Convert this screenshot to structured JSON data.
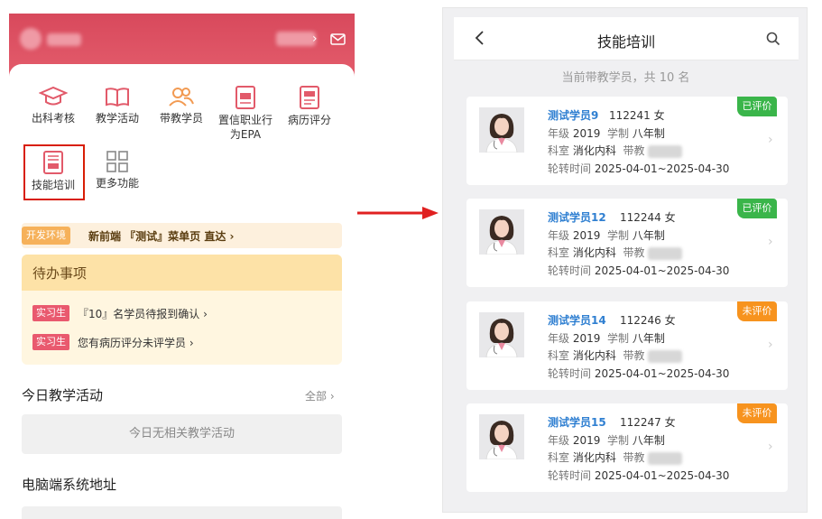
{
  "colors": {
    "accent": "#d8495c",
    "evaluated": "#3ab54a",
    "not_evaluated": "#f7931e",
    "link": "#2f7fd1",
    "highlight": "#d81e06"
  },
  "left": {
    "functions": [
      {
        "label": "出科考核",
        "icon": "graduation-cap-icon"
      },
      {
        "label": "教学活动",
        "icon": "book-icon"
      },
      {
        "label": "带教学员",
        "icon": "students-icon"
      },
      {
        "label": "置信职业行为EPA",
        "icon": "epa-icon"
      },
      {
        "label": "病历评分",
        "icon": "record-icon"
      },
      {
        "label": "技能培训",
        "icon": "skill-training-icon",
        "highlighted": true
      },
      {
        "label": "更多功能",
        "icon": "grid-icon"
      }
    ],
    "dev_banner": {
      "tag": "开发环境",
      "text": "新前端 『测试』菜单页 直达 ›"
    },
    "todo": {
      "title": "待办事项",
      "items": [
        {
          "tag": "实习生",
          "text": "『10』名学员待报到确认 ›"
        },
        {
          "tag": "实习生",
          "text": "您有病历评分未评学员 ›"
        }
      ]
    },
    "today": {
      "title": "今日教学活动",
      "all": "全部 ›",
      "empty": "今日无相关教学活动"
    },
    "pc_address": {
      "title": "电脑端系统地址"
    }
  },
  "right": {
    "title": "技能培训",
    "summary": "当前带教学员，共 10 名",
    "labels": {
      "grade": "年级",
      "system": "学制",
      "dept": "科室",
      "teacher": "带教",
      "rotation": "轮转时间"
    },
    "students": [
      {
        "name": "测试学员9",
        "id": "112241",
        "gender": "女",
        "grade": "2019",
        "system": "八年制",
        "dept": "消化内科",
        "period": "2025-04-01~2025-04-30",
        "status": "已评价",
        "evaluated": true
      },
      {
        "name": "测试学员12",
        "id": "112244",
        "gender": "女",
        "grade": "2019",
        "system": "八年制",
        "dept": "消化内科",
        "period": "2025-04-01~2025-04-30",
        "status": "已评价",
        "evaluated": true
      },
      {
        "name": "测试学员14",
        "id": "112246",
        "gender": "女",
        "grade": "2019",
        "system": "八年制",
        "dept": "消化内科",
        "period": "2025-04-01~2025-04-30",
        "status": "未评价",
        "evaluated": false
      },
      {
        "name": "测试学员15",
        "id": "112247",
        "gender": "女",
        "grade": "2019",
        "system": "八年制",
        "dept": "消化内科",
        "period": "2025-04-01~2025-04-30",
        "status": "未评价",
        "evaluated": false
      }
    ]
  }
}
